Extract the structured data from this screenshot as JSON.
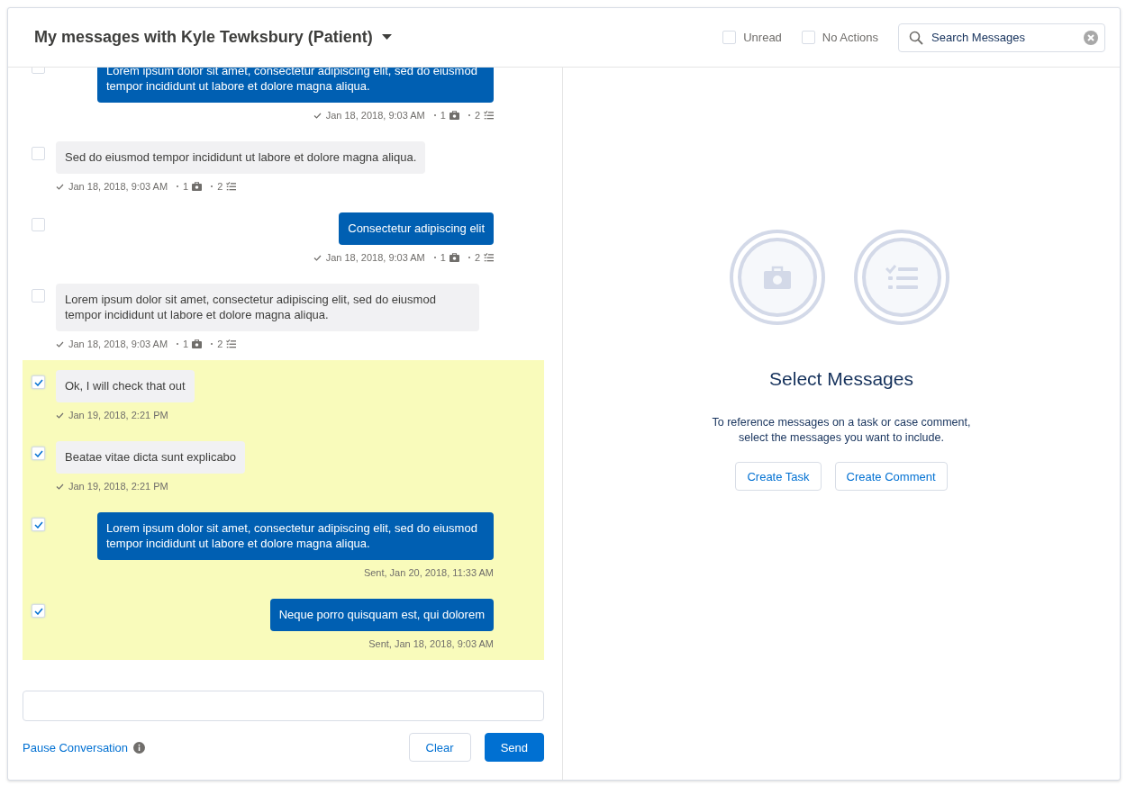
{
  "header": {
    "title": "My messages with Kyle Tewksbury (Patient)",
    "filters": [
      {
        "label": "Unread",
        "checked": false
      },
      {
        "label": "No Actions",
        "checked": false
      }
    ],
    "search": {
      "placeholder": "Search Messages"
    }
  },
  "messages": [
    {
      "kind": "sent",
      "checked": false,
      "text": "Lorem ipsum dolor sit amet, consectetur adipiscing elit, sed do eiusmod tempor incididunt ut labore et dolore magna aliqua.",
      "time": "Jan 18, 2018, 9:03 AM",
      "delivered": true,
      "cases": "1",
      "tasks": "2"
    },
    {
      "kind": "received",
      "checked": false,
      "text": "Sed do eiusmod tempor incididunt ut labore et dolore magna aliqua.",
      "time": "Jan 18, 2018, 9:03 AM",
      "delivered": true,
      "cases": "1",
      "tasks": "2"
    },
    {
      "kind": "sent",
      "checked": false,
      "text": "Consectetur adipiscing elit",
      "time": "Jan 18, 2018, 9:03 AM",
      "delivered": true,
      "cases": "1",
      "tasks": "2"
    },
    {
      "kind": "received",
      "checked": false,
      "text": "Lorem ipsum dolor sit amet, consectetur adipiscing elit, sed do eiusmod tempor incididunt ut labore et dolore magna aliqua.",
      "time": "Jan 18, 2018, 9:03 AM",
      "delivered": true,
      "cases": "1",
      "tasks": "2"
    },
    {
      "kind": "received",
      "checked": true,
      "text": "Ok, I will check that out",
      "time": "Jan 19, 2018, 2:21 PM",
      "delivered": true
    },
    {
      "kind": "received",
      "checked": true,
      "text": "Beatae vitae dicta sunt explicabo",
      "time": "Jan 19, 2018, 2:21 PM",
      "delivered": true
    },
    {
      "kind": "sent",
      "checked": true,
      "text": "Lorem ipsum dolor sit amet, consectetur adipiscing elit, sed do eiusmod tempor incididunt ut labore et dolore magna aliqua.",
      "time": "Sent, Jan 20, 2018, 11:33 AM",
      "delivered": false
    },
    {
      "kind": "sent",
      "checked": true,
      "text": "Neque porro quisquam est, qui dolorem",
      "time": "Sent, Jan 18, 2018, 9:03 AM",
      "delivered": false
    }
  ],
  "composer": {
    "pause_link": "Pause Conversation",
    "buttons": [
      {
        "label": "Clear",
        "kind": "neutral"
      },
      {
        "label": "Send",
        "kind": "brand"
      }
    ]
  },
  "empty_state": {
    "title": "Select Messages",
    "description": "To reference messages on a task or case comment, select the messages you want to include.",
    "buttons": [
      "Create Task",
      "Create Comment"
    ]
  }
}
